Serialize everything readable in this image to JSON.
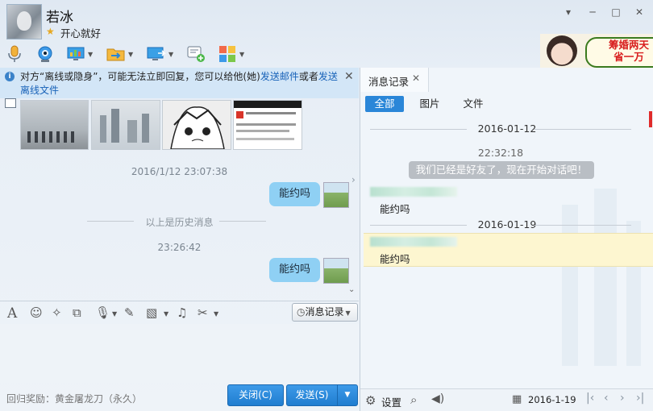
{
  "contact": {
    "name": "若冰",
    "signature": "开心就好"
  },
  "window_controls": {
    "menu": "▾",
    "minimize": "─",
    "maximize": "□",
    "close": "✕"
  },
  "toolbar": {
    "icons": [
      "microphone-icon",
      "video-camera-icon",
      "screen-share-icon",
      "file-transfer-icon",
      "remote-desktop-icon",
      "new-message-icon",
      "apps-icon"
    ]
  },
  "ad": {
    "line1": "筹婚两天",
    "line2": "省一万"
  },
  "notice": {
    "text1": "对方“离线或隐身”，可能无法立即回复，您可以给他(她)",
    "link1": "发送邮件",
    "text2": "或者",
    "link2": "发送离线文件",
    "close": "✕"
  },
  "chat": {
    "time1": "2016/1/12 23:07:38",
    "msg1": "能约吗",
    "history_divider": "以上是历史消息",
    "time2": "23:26:42",
    "msg2": "能约吗"
  },
  "editor": {
    "history_button": "消息记录",
    "reward": "回归奖励：黄金屠龙刀（永久）",
    "close_button": "关闭(C)",
    "send_button": "发送(S)"
  },
  "history_panel": {
    "tab_label": "消息记录",
    "filters": [
      "全部",
      "图片",
      "文件"
    ],
    "active_filter": "全部",
    "date1": "2016-01-12",
    "time1": "22:32:18",
    "system_message": "我们已经是好友了，现在开始对话吧！",
    "entry1": "能约吗",
    "date2": "2016-01-19",
    "entry2": "能约吗",
    "settings_label": "设置",
    "current_date": "2016-1-19"
  },
  "colors": {
    "accent": "#2a86d8",
    "bubble": "#8fd0f4",
    "highlight": "#fdf6d0"
  }
}
